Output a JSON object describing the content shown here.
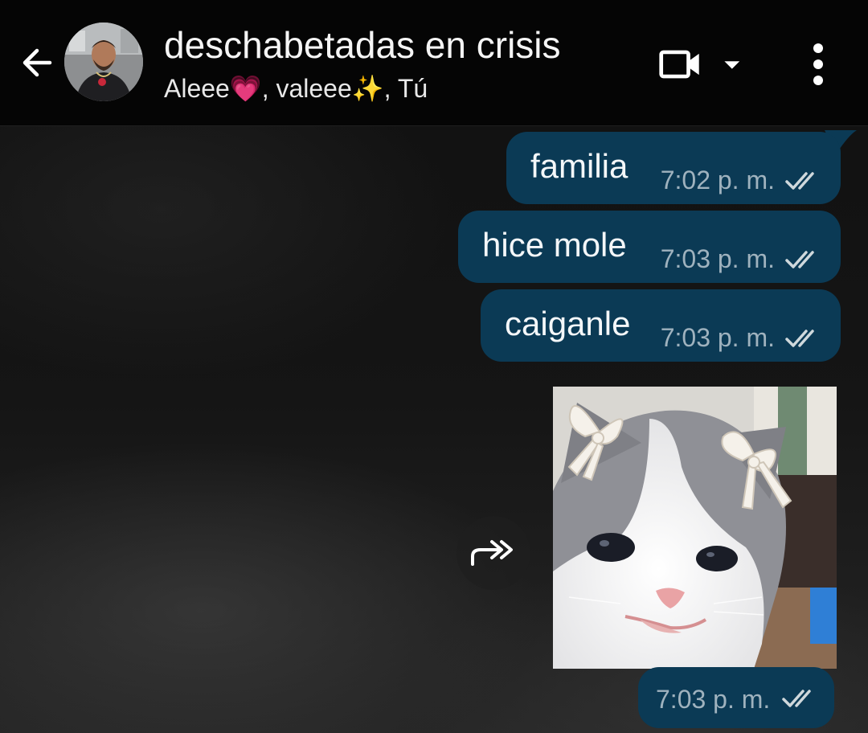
{
  "header": {
    "title": "deschabetadas en crisis",
    "members": "Aleee💗, valeee✨, Tú",
    "icons": {
      "back": "back-arrow-icon",
      "video_call": "video-camera-icon",
      "dropdown": "caret-down-icon",
      "menu": "more-vert-icon"
    }
  },
  "messages": [
    {
      "text": "familia",
      "time": "7:02 p. m.",
      "status": "read"
    },
    {
      "text": "hice mole",
      "time": "7:03 p. m.",
      "status": "read"
    },
    {
      "text": "caiganle",
      "time": "7:03 p. m.",
      "status": "read"
    }
  ],
  "media_message": {
    "type": "sticker-image",
    "subject": "kitten with bows",
    "time": "7:03 p. m.",
    "status": "read",
    "forward_icon": "forward-icon"
  },
  "colors": {
    "header_bg": "#050505",
    "bubble_bg": "#0b3a55",
    "time_text": "#9fb2be",
    "tick": "#cfd8dc"
  }
}
